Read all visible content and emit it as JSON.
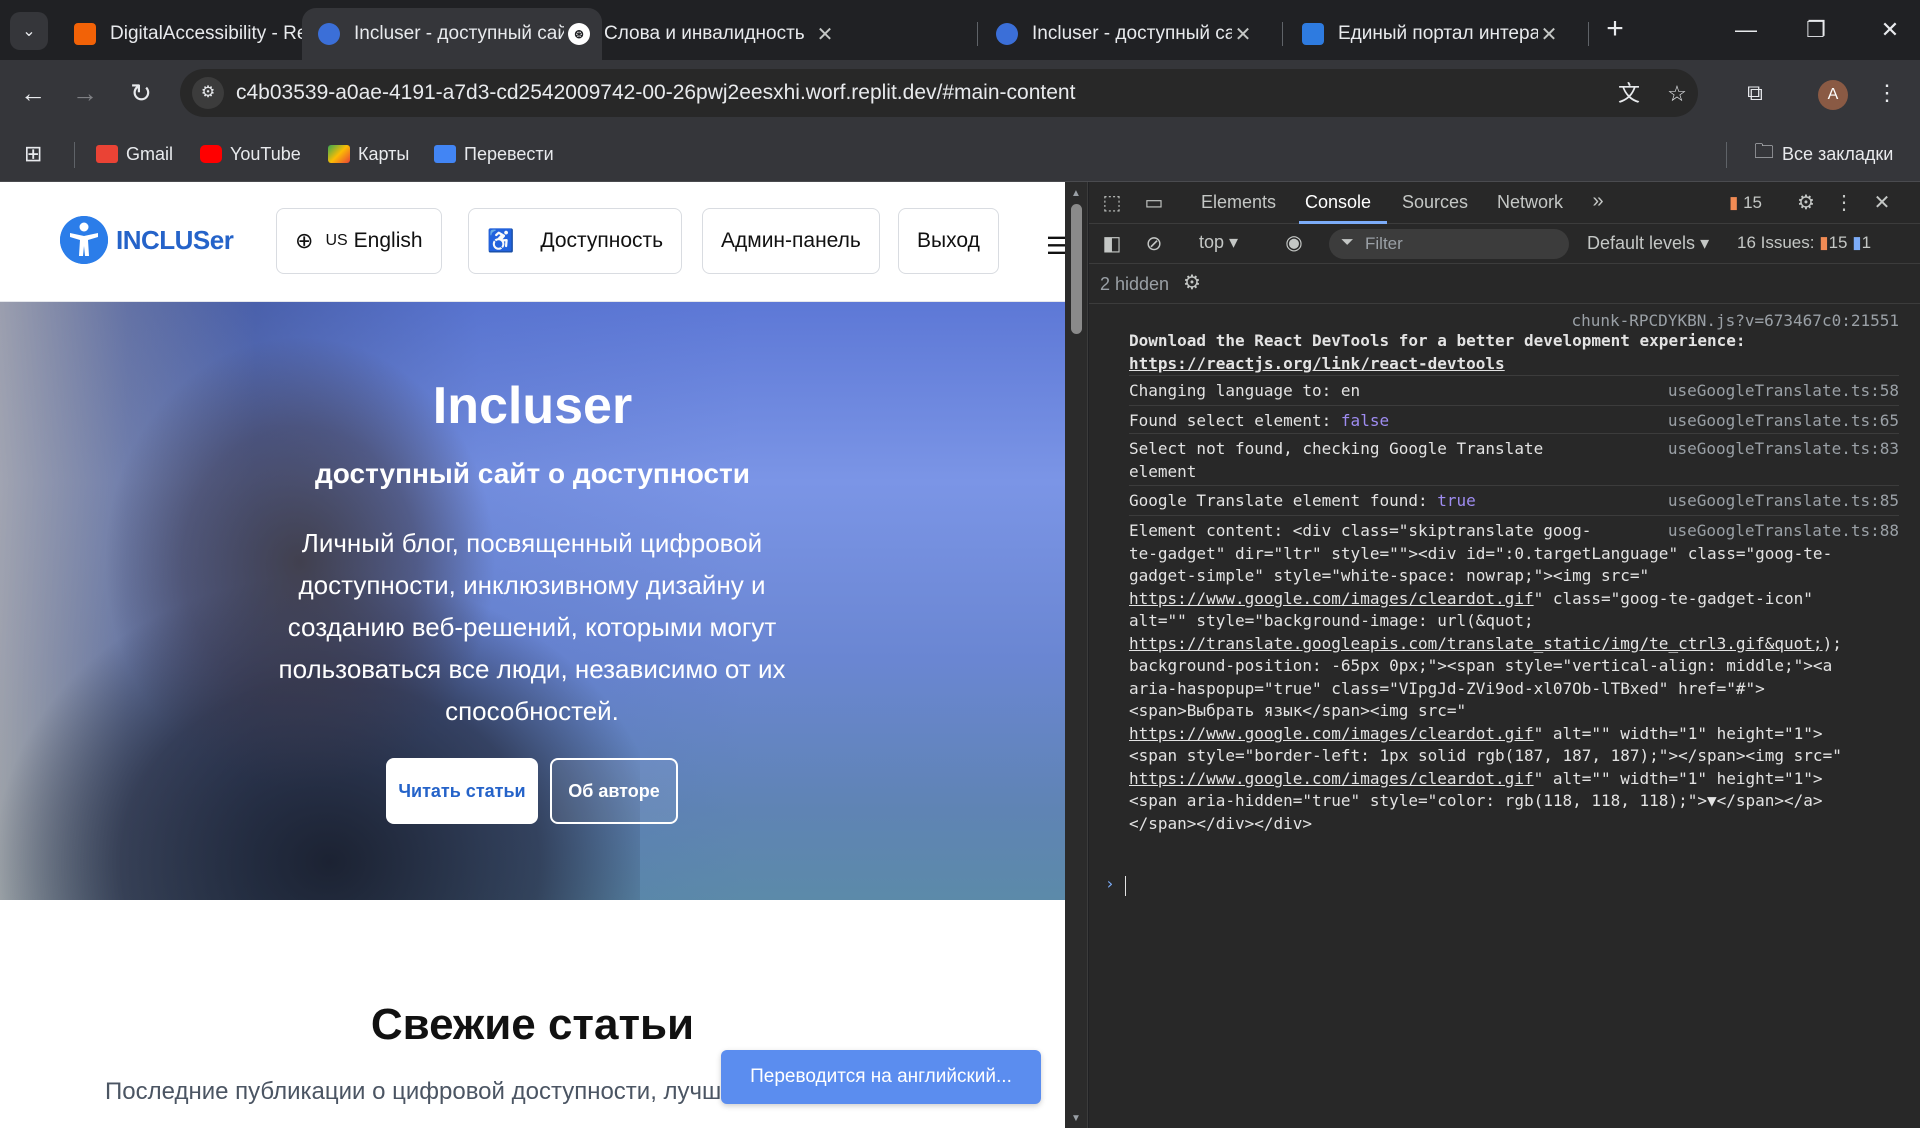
{
  "browser": {
    "tabs": [
      {
        "title": "DigitalAccessibility - Repl",
        "favicon_color": "#f26207",
        "active": false
      },
      {
        "title": "Incluser - доступный сай",
        "favicon_color": "#3b6fd8",
        "active": true
      },
      {
        "title": "Слова и инвалидность",
        "favicon_color": "#ffffff",
        "active": false
      },
      {
        "title": "Incluser - доступный сай",
        "favicon_color": "#3b6fd8",
        "active": false
      },
      {
        "title": "Единый портал интерак",
        "favicon_color": "#2e7be0",
        "active": false
      }
    ],
    "url": "c4b03539-a0ae-4191-a7d3-cd2542009742-00-26pwj2eesxhi.worf.replit.dev/#main-content",
    "profile_initial": "A",
    "bookmarks": [
      {
        "label": "Gmail",
        "icon": "gmail-icon",
        "color": "#ea4335"
      },
      {
        "label": "YouTube",
        "icon": "youtube-icon",
        "color": "#ff0000"
      },
      {
        "label": "Карты",
        "icon": "maps-icon",
        "color": "#34a853"
      },
      {
        "label": "Перевести",
        "icon": "translate-icon",
        "color": "#4285f4"
      }
    ],
    "all_bookmarks": "Все закладки"
  },
  "site": {
    "logo_text": "INCLUSer",
    "lang_prefix": "US",
    "lang_label": "English",
    "accessibility_label": "Доступность",
    "admin_label": "Админ-панель",
    "logout_label": "Выход",
    "hero": {
      "title": "Incluser",
      "subtitle": "доступный сайт о доступности",
      "description": "Личный блог, посвященный цифровой доступности, инклюзивному дизайну и созданию веб-решений, которыми могут пользоваться все люди, независимо от их способностей.",
      "read_button": "Читать статьи",
      "about_button": "Об авторе"
    },
    "fresh_title": "Свежие статьи",
    "fresh_desc": "Последние публикации о цифровой доступности, лучших практиках и новых",
    "toast": "Переводится на английский..."
  },
  "devtools": {
    "tabs": [
      "Elements",
      "Console",
      "Sources",
      "Network"
    ],
    "active_tab": "Console",
    "issues_badge": "15",
    "context": "top",
    "filter_placeholder": "Filter",
    "levels": "Default levels",
    "issues_label": "16 Issues:",
    "issues_warn": "15",
    "issues_info": "1",
    "hidden_label": "2 hidden",
    "messages": [
      {
        "src": "chunk-RPCDYKBN.js?v=673467c0:21551",
        "bold": "Download the React DevTools for a better development experience:",
        "link": "https://reactjs.org/link/react-devtools"
      },
      {
        "src": "useGoogleTranslate.ts:58",
        "text": "Changing language to: en"
      },
      {
        "src": "useGoogleTranslate.ts:65",
        "text": "Found select element: ",
        "value": "false"
      },
      {
        "src": "useGoogleTranslate.ts:83",
        "text": "Select not found, checking Google Translate\nelement"
      },
      {
        "src": "useGoogleTranslate.ts:85",
        "text": "Google Translate element found: ",
        "value": "true"
      },
      {
        "src": "useGoogleTranslate.ts:88",
        "l1": "Element content: <div class=\"skiptranslate goog-",
        "l2": "te-gadget\" dir=\"ltr\" style=\"\"><div id=\":0.targetLanguage\" class=\"goog-te-",
        "l3": "gadget-simple\" style=\"white-space: nowrap;\"><img src=\"",
        "link1": "https://www.google.com/images/cleardot.gif",
        "l4": "\" class=\"goog-te-gadget-icon\"",
        "l5": "alt=\"\" style=\"background-image: url(&quot;",
        "link2": "https://translate.googleapis.com/translate_static/img/te_ctrl3.gif&quot;",
        "l6": ");",
        "l7": "background-position: -65px 0px;\"><span style=\"vertical-align: middle;\"><a",
        "l8": "aria-haspopup=\"true\" class=\"VIpgJd-ZVi9od-xl07Ob-lTBxed\" href=\"#\">",
        "l9": "<span>Выбрать язык</span><img src=\"",
        "link3": "https://www.google.com/images/cleardot.gif",
        "l10": "\" alt=\"\" width=\"1\" height=\"1\">",
        "l11": "<span style=\"border-left: 1px solid rgb(187, 187, 187);\"></span><img src=\"",
        "link4": "https://www.google.com/images/cleardot.gif",
        "l12": "\" alt=\"\" width=\"1\" height=\"1\">",
        "l13": "<span aria-hidden=\"true\" style=\"color: rgb(118, 118, 118);\">▼</span></a>",
        "l14": "</span></div></div>"
      }
    ],
    "prompt": "›"
  }
}
